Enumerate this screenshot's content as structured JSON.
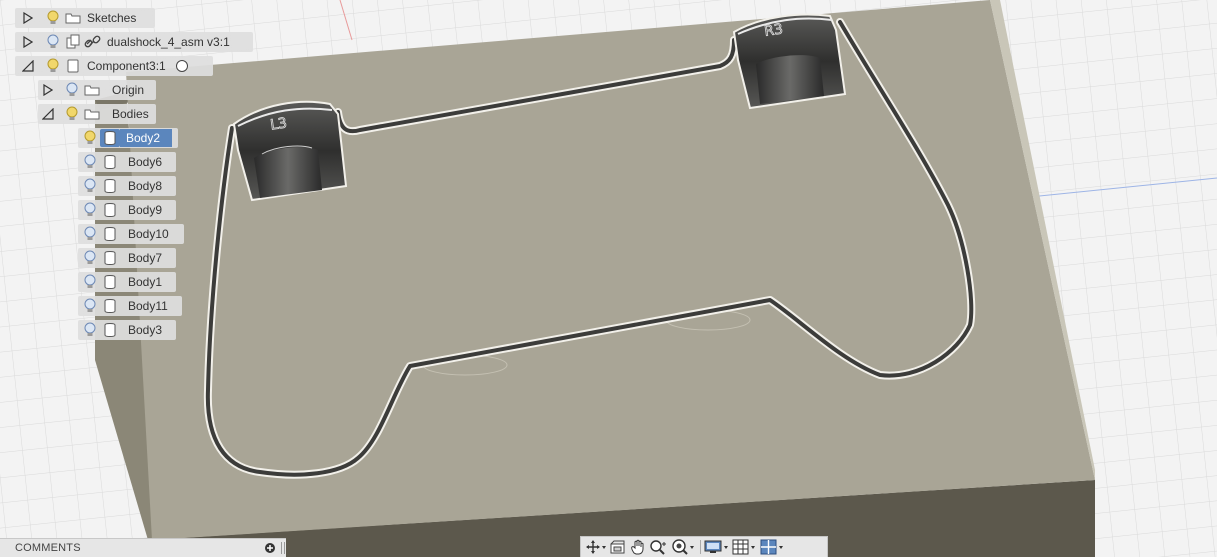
{
  "browser": {
    "rows": [
      {
        "label": "Sketches",
        "type": "folder",
        "expand": "collapsed"
      },
      {
        "label": "dualshock_4_asm v3:1",
        "type": "linked-component",
        "expand": "collapsed"
      },
      {
        "label": "Component3:1",
        "type": "component",
        "expand": "expanded"
      },
      {
        "label": "Origin",
        "type": "folder",
        "expand": "collapsed"
      },
      {
        "label": "Bodies",
        "type": "folder",
        "expand": "expanded"
      },
      {
        "label": "Body2",
        "type": "body",
        "selected": true
      },
      {
        "label": "Body6",
        "type": "body"
      },
      {
        "label": "Body8",
        "type": "body"
      },
      {
        "label": "Body9",
        "type": "body"
      },
      {
        "label": "Body10",
        "type": "body"
      },
      {
        "label": "Body7",
        "type": "body"
      },
      {
        "label": "Body1",
        "type": "body"
      },
      {
        "label": "Body11",
        "type": "body"
      },
      {
        "label": "Body3",
        "type": "body"
      }
    ]
  },
  "model": {
    "left_pad_label": "L3",
    "right_pad_label": "R3",
    "colors": {
      "block_top": "#a9a596",
      "block_side": "#5e5a4e",
      "block_left_side": "#8a8676",
      "groove": "#3e3e3c",
      "selection": "#5b86bd"
    }
  },
  "comments": {
    "label": "COMMENTS",
    "add_icon": "plus-circle-icon"
  },
  "navbar": {
    "icons": [
      "orbit-icon",
      "look-at-icon",
      "pan-icon",
      "zoom-icon",
      "fit-icon",
      "display-settings-icon",
      "grid-settings-icon",
      "viewports-icon"
    ]
  }
}
